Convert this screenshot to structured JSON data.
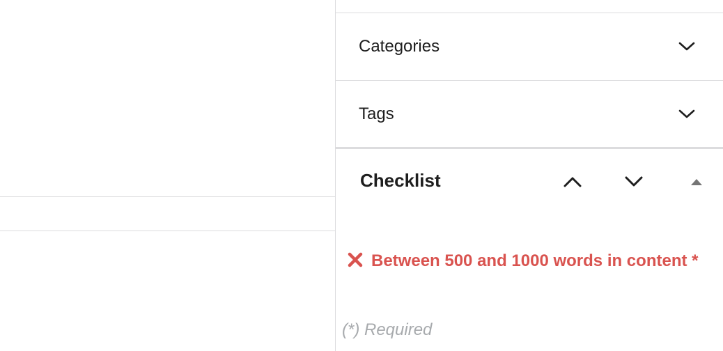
{
  "sidebar": {
    "panels": [
      {
        "label": "Categories",
        "toggle_icon": "chevron-down-icon"
      },
      {
        "label": "Tags",
        "toggle_icon": "chevron-down-icon"
      }
    ],
    "checklist": {
      "title": "Checklist",
      "move_up_icon": "chevron-up-icon",
      "move_down_icon": "chevron-down-icon",
      "collapse_icon": "triangle-up-icon",
      "requirements": [
        {
          "status": "failed",
          "status_icon": "x-mark-icon",
          "text": "Between 500 and 1000 words in content *"
        }
      ],
      "required_note": "(*) Required"
    }
  },
  "colors": {
    "error": "#d9534f",
    "muted": "#a7aaad",
    "border": "#dcdcde",
    "text": "#1e1e1e"
  }
}
